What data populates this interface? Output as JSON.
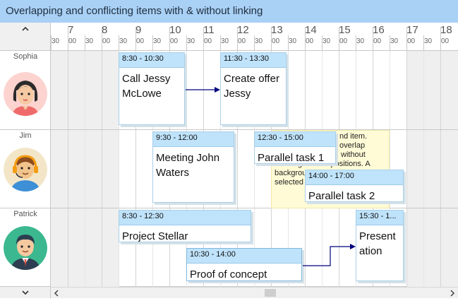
{
  "window": {
    "title": "Overlapping and conflicting items with & without linking"
  },
  "timeline": {
    "hours": [
      "7",
      "8",
      "9",
      "10",
      "11",
      "12",
      "13",
      "14",
      "15",
      "16",
      "17",
      "18"
    ],
    "half_labels": [
      "30",
      "00",
      "30"
    ]
  },
  "resources": [
    {
      "name": "Sophia"
    },
    {
      "name": "Jim"
    },
    {
      "name": "Patrick"
    }
  ],
  "items": {
    "call_jessy": {
      "time": "8:30 - 10:30",
      "title": "Call Jessy McLowe"
    },
    "create_offer": {
      "time": "11:30 - 13:30",
      "title": "Create offer Jessy"
    },
    "meeting_john": {
      "time": "9:30 - 12:00",
      "title": "Meeting John Waters"
    },
    "parallel_1": {
      "time": "12:30 - 15:00",
      "title": "Parallel task 1"
    },
    "parallel_2": {
      "time": "14:00 - 17:00",
      "title": "Parallel task 2"
    },
    "project_stellar": {
      "time": "8:30 - 12:30",
      "title": "Project Stellar"
    },
    "proof_concept": {
      "time": "10:30 - 14:00",
      "title": "Proof of concept"
    },
    "presentation": {
      "time": "15:30 - 1...",
      "title": "Presentation"
    }
  },
  "selected_item": {
    "lines": [
      "nd item.",
      "overlap",
      "without",
      "creating conflict positions. A",
      "backgrou",
      "selected"
    ]
  },
  "controls": {
    "collapse_glyph": "^",
    "expand_glyph": "v",
    "scroll_left_glyph": "<",
    "scroll_right_glyph": ">"
  },
  "colors": {
    "title_bar": "#a9d0f5",
    "item_header": "#bfe3fb",
    "selection_note": "#fffbd6",
    "link_line": "#00007f"
  }
}
